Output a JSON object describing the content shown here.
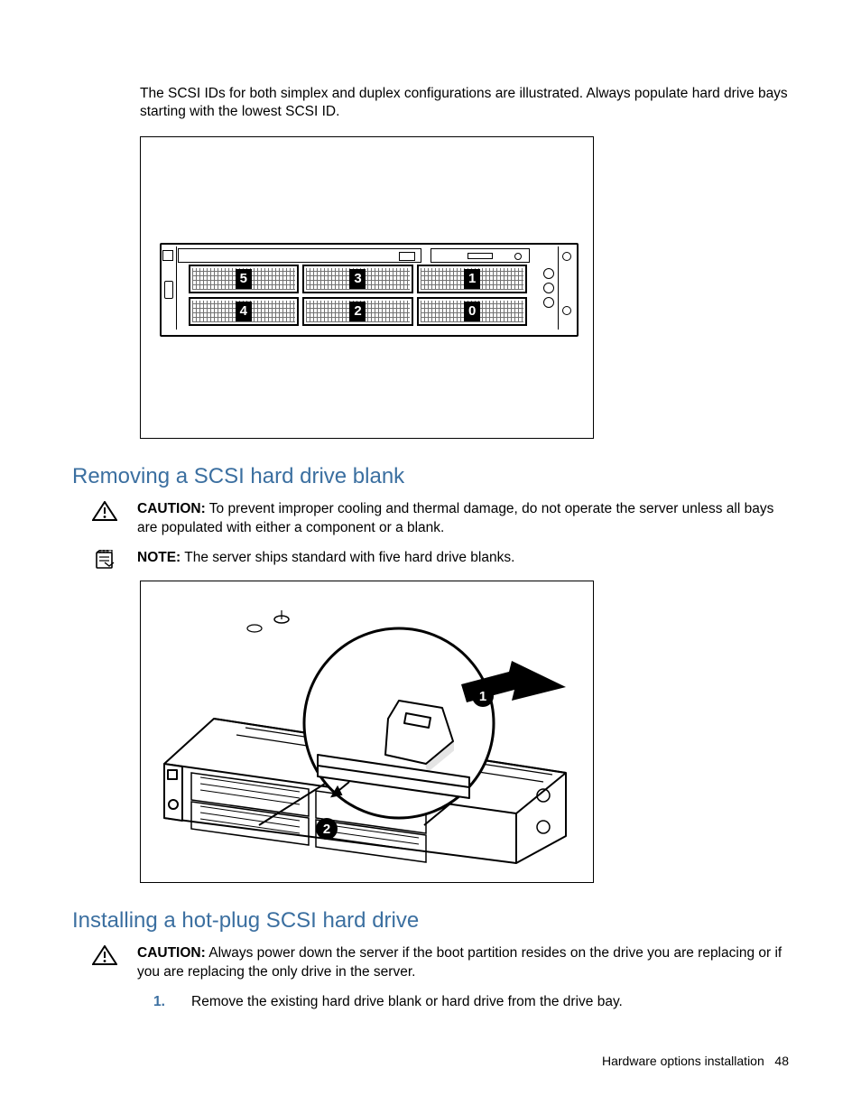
{
  "intro_text": "The SCSI IDs for both simplex and duplex configurations are illustrated. Always populate hard drive bays starting with the lowest SCSI ID.",
  "fig1": {
    "bay_numbers": [
      "5",
      "3",
      "1",
      "4",
      "2",
      "0"
    ]
  },
  "section1": {
    "title": "Removing a SCSI hard drive blank",
    "caution_label": "CAUTION:",
    "caution_text": " To prevent improper cooling and thermal damage, do not operate the server unless all bays are populated with either a component or a blank.",
    "note_label": "NOTE:",
    "note_text": " The server ships standard with five hard drive blanks."
  },
  "section2": {
    "title": "Installing a hot-plug SCSI hard drive",
    "caution_label": "CAUTION:",
    "caution_text": " Always power down the server if the boot partition resides on the drive you are replacing or if you are replacing the only drive in the server.",
    "steps": [
      "Remove the existing hard drive blank or hard drive from the drive bay."
    ]
  },
  "footer": {
    "section": "Hardware options installation",
    "page": "48"
  }
}
